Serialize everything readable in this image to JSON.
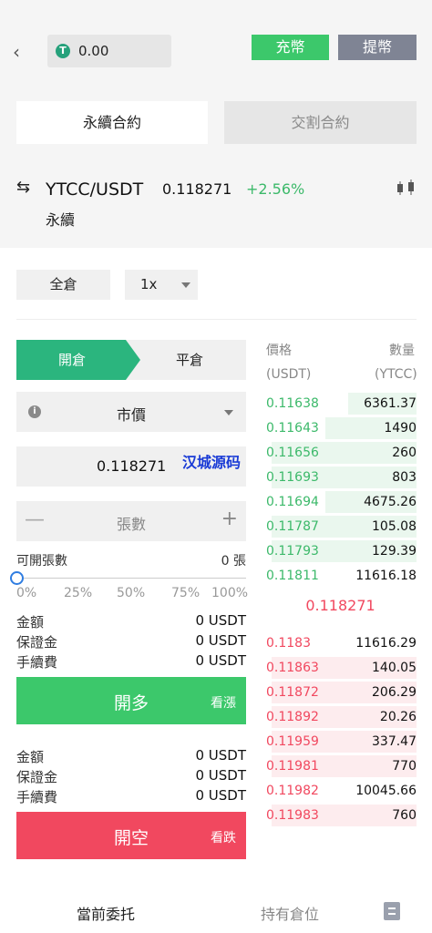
{
  "header": {
    "balance": "0.00",
    "deposit_label": "充幣",
    "withdraw_label": "提幣",
    "tab_perpetual": "永續合約",
    "tab_delivery": "交割合約"
  },
  "market": {
    "pair": "YTCC/USDT",
    "price": "0.118271",
    "change": "+2.56%",
    "type": "永續"
  },
  "settings": {
    "margin_mode": "全倉",
    "leverage": "1x"
  },
  "order": {
    "open_label": "開倉",
    "close_label": "平倉",
    "order_type": "市價",
    "price_value": "0.118271",
    "watermark": "汉城源码",
    "qty_placeholder": "張數",
    "available_label": "可開張數",
    "available_value": "0 張",
    "slider_percent": 0,
    "percents": [
      "0%",
      "25%",
      "50%",
      "75%",
      "100%"
    ]
  },
  "buy_summary": {
    "amount_label": "金額",
    "amount_value": "0 USDT",
    "margin_label": "保證金",
    "margin_value": "0 USDT",
    "fee_label": "手續費",
    "fee_value": "0 USDT",
    "button_label": "開多",
    "button_sub": "看漲"
  },
  "sell_summary": {
    "amount_label": "金額",
    "amount_value": "0 USDT",
    "margin_label": "保證金",
    "margin_value": "0 USDT",
    "fee_label": "手續費",
    "fee_value": "0 USDT",
    "button_label": "開空",
    "button_sub": "看跌"
  },
  "orderbook": {
    "price_header": "價格",
    "qty_header": "數量",
    "price_unit": "(USDT)",
    "qty_unit": "(YTCC)",
    "last_price": "0.118271",
    "bids": [
      {
        "price": "0.11638",
        "qty": "6361.37",
        "depth": 0.45
      },
      {
        "price": "0.11643",
        "qty": "1490",
        "depth": 0.6
      },
      {
        "price": "0.11656",
        "qty": "260",
        "depth": 0.95
      },
      {
        "price": "0.11693",
        "qty": "803",
        "depth": 0.95
      },
      {
        "price": "0.11694",
        "qty": "4675.26",
        "depth": 0.6
      },
      {
        "price": "0.11787",
        "qty": "105.08",
        "depth": 0.95
      },
      {
        "price": "0.11793",
        "qty": "129.39",
        "depth": 0.95
      },
      {
        "price": "0.11811",
        "qty": "11616.18",
        "depth": 0
      }
    ],
    "asks": [
      {
        "price": "0.1183",
        "qty": "11616.29",
        "depth": 0
      },
      {
        "price": "0.11863",
        "qty": "140.05",
        "depth": 0.95
      },
      {
        "price": "0.11872",
        "qty": "206.29",
        "depth": 0.95
      },
      {
        "price": "0.11892",
        "qty": "20.26",
        "depth": 0.95
      },
      {
        "price": "0.11959",
        "qty": "337.47",
        "depth": 0.95
      },
      {
        "price": "0.11981",
        "qty": "770",
        "depth": 0.95
      },
      {
        "price": "0.11982",
        "qty": "10045.66",
        "depth": 0
      },
      {
        "price": "0.11983",
        "qty": "760",
        "depth": 0.95
      }
    ]
  },
  "footer": {
    "tab_current_orders": "當前委托",
    "tab_positions": "持有倉位"
  },
  "colors": {
    "green": "#3cc86b",
    "teal": "#2bb57e",
    "red": "#f1485f",
    "bid_bg": "#eaf7ee",
    "ask_bg": "#fdecee"
  }
}
